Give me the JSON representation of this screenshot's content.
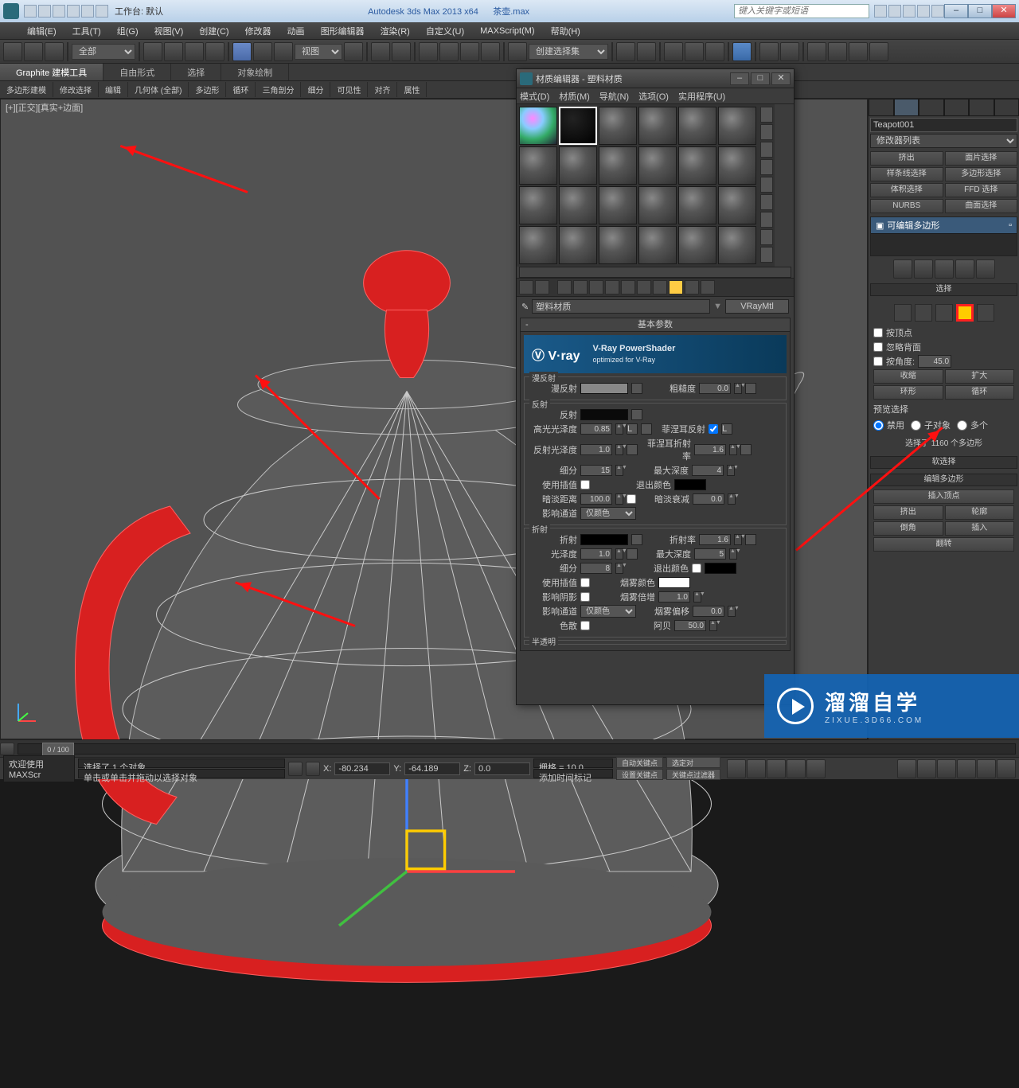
{
  "titlebar": {
    "workspace_label": "工作台: 默认",
    "app_title": "Autodesk 3ds Max  2013 x64",
    "filename": "茶壶.max",
    "search_placeholder": "键入关键字或短语"
  },
  "menubar": [
    "编辑(E)",
    "工具(T)",
    "组(G)",
    "视图(V)",
    "创建(C)",
    "修改器",
    "动画",
    "图形编辑器",
    "渲染(R)",
    "自定义(U)",
    "MAXScript(M)",
    "帮助(H)"
  ],
  "toolbar": {
    "filter": "全部",
    "refcoord": "视图",
    "namedsel": "创建选择集"
  },
  "ribbon_tabs": [
    "Graphite 建模工具",
    "自由形式",
    "选择",
    "对象绘制"
  ],
  "ribbon2": [
    "多边形建模",
    "修改选择",
    "编辑",
    "几何体 (全部)",
    "多边形",
    "循环",
    "三角剖分",
    "细分",
    "可见性",
    "对齐",
    "属性"
  ],
  "viewport": {
    "label": "[+][正交][真实+边面]"
  },
  "mateditor": {
    "title": "材质编辑器 - 塑料材质",
    "menus": [
      "模式(D)",
      "材质(M)",
      "导航(N)",
      "选项(O)",
      "实用程序(U)"
    ],
    "material_name": "塑料材质",
    "material_type": "VRayMtl",
    "rollout_basic": "基本参数",
    "vray_title": "V-Ray PowerShader",
    "vray_sub": "optimized for V-Ray",
    "groups": {
      "diffuse": {
        "title": "漫反射",
        "diffuse_label": "漫反射",
        "roughness_label": "粗糙度",
        "roughness": "0.0"
      },
      "reflect": {
        "title": "反射",
        "reflect_label": "反射",
        "hilight_label": "高光光泽度",
        "hilight": "0.85",
        "refl_gloss_label": "反射光泽度",
        "refl_gloss": "1.0",
        "subdiv_label": "细分",
        "subdiv": "15",
        "use_interp_label": "使用插值",
        "dim_dist_label": "暗淡距离",
        "dim_dist": "100.0",
        "affect_label": "影响通道",
        "affect": "仅颜色",
        "fresnel_label": "菲涅耳反射",
        "fresnel_ior_label": "菲涅耳折射率",
        "fresnel_ior": "1.6",
        "max_depth_label": "最大深度",
        "max_depth": "4",
        "exit_color_label": "退出颜色",
        "dim_falloff_label": "暗淡衰减",
        "dim_falloff": "0.0"
      },
      "refract": {
        "title": "折射",
        "refract_label": "折射",
        "gloss_label": "光泽度",
        "gloss": "1.0",
        "subdiv_label": "细分",
        "subdiv": "8",
        "use_interp_label": "使用插值",
        "shadows_label": "影响阴影",
        "affect_label": "影响通道",
        "affect": "仅颜色",
        "dispersion_label": "色散",
        "ior_label": "折射率",
        "ior": "1.6",
        "max_depth_label": "最大深度",
        "max_depth": "5",
        "exit_color_label": "退出颜色",
        "fog_color_label": "烟雾颜色",
        "fog_mult_label": "烟雾倍增",
        "fog_mult": "1.0",
        "fog_bias_label": "烟雾偏移",
        "fog_bias": "0.0",
        "abbe_label": "阿贝",
        "abbe": "50.0"
      },
      "translucent": "半透明"
    }
  },
  "sidepanel": {
    "object_name": "Teapot001",
    "modifier_list": "修改器列表",
    "buttons": [
      [
        "挤出",
        "面片选择"
      ],
      [
        "样条线选择",
        "多边形选择"
      ],
      [
        "体积选择",
        "FFD 选择"
      ],
      [
        "NURBS",
        "曲面选择"
      ]
    ],
    "stack_item": "可编辑多边形",
    "rollout_select": "选择",
    "by_vertex": "按顶点",
    "ignore_back": "忽略背面",
    "by_angle": "按角度:",
    "angle_val": "45.0",
    "shrink": "收缩",
    "grow": "扩大",
    "ring": "环形",
    "loop": "循环",
    "preview_label": "预览选择",
    "preview_opts": [
      "禁用",
      "子对象",
      "多个"
    ],
    "sel_status": "选择了 1160 个多边形",
    "rollout_soft": "软选择",
    "rollout_editpoly": "编辑多边形",
    "insert_vertex": "插入顶点",
    "edit_btns": [
      [
        "挤出",
        "轮廓"
      ],
      [
        "倒角",
        "插入"
      ]
    ],
    "flip": "翻转"
  },
  "timeline": {
    "range": "0 / 100"
  },
  "statusbar": {
    "welcome": "欢迎使用  MAXScr",
    "sel_info": "选择了 1 个对象",
    "hint": "单击或单击并拖动以选择对象",
    "x": "-80.234",
    "y": "-64.189",
    "z": "0.0",
    "grid": "栅格 = 10.0",
    "addtime": "添加时间标记",
    "autokey": "自动关键点",
    "setkey": "设置关键点",
    "selected_btn": "选定对",
    "keyfilter": "关键点过滤器"
  },
  "watermark": {
    "cn": "溜溜自学",
    "en": "ZIXUE.3D66.COM"
  }
}
